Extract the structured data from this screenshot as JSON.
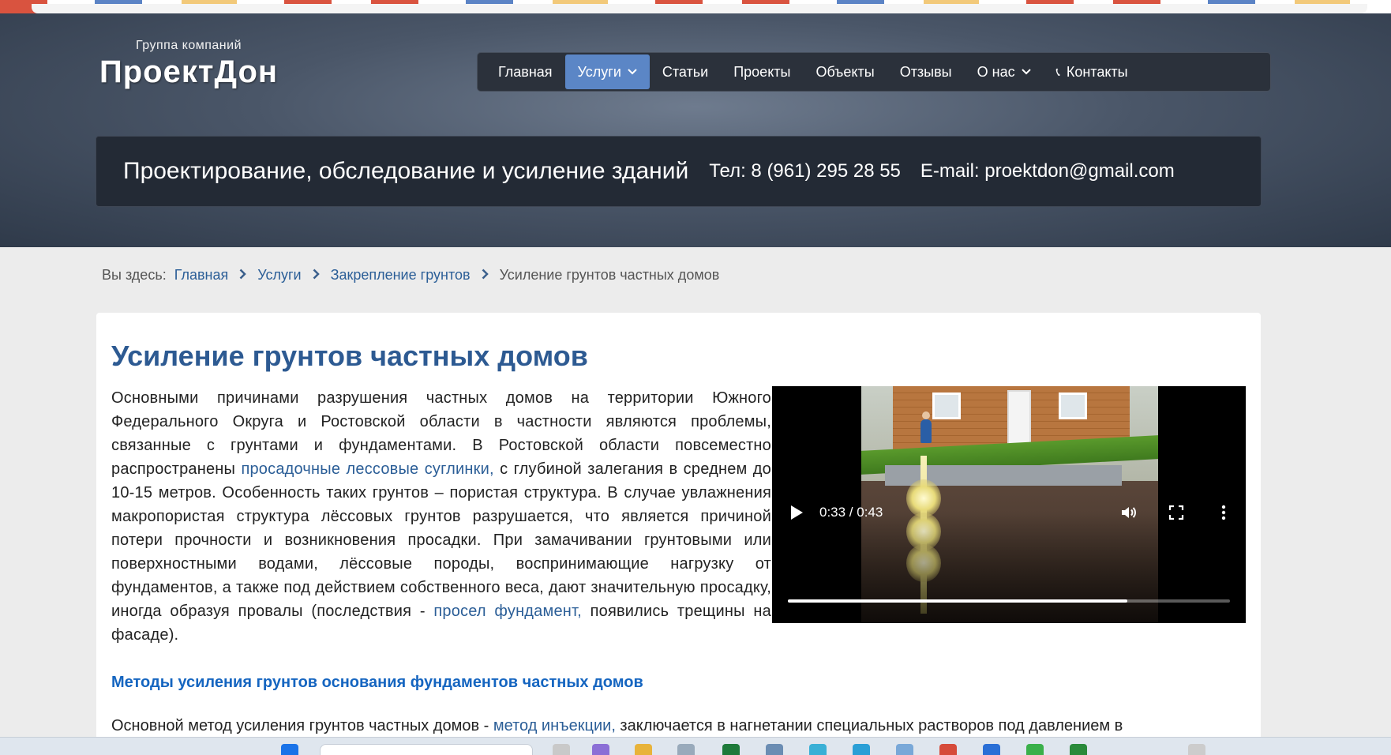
{
  "header": {
    "logo_small": "Группа компаний",
    "logo_big": "ПроектДон",
    "nav": [
      {
        "label": "Главная"
      },
      {
        "label": "Услуги",
        "active": true,
        "dropdown": true
      },
      {
        "label": "Статьи"
      },
      {
        "label": "Проекты"
      },
      {
        "label": "Объекты"
      },
      {
        "label": "Отзывы"
      },
      {
        "label": "О нас",
        "dropdown": true
      },
      {
        "label": "Контакты",
        "icon": "phone-icon"
      }
    ],
    "tagline": "Проектирование, обследование и усиление зданий",
    "phone": "Тел: 8 (961) 295 28 55",
    "email": "E-mail: proektdon@gmail.com"
  },
  "breadcrumb": {
    "prefix": "Вы здесь:",
    "items": [
      "Главная",
      "Услуги",
      "Закрепление грунтов"
    ],
    "current": "Усиление грунтов частных домов"
  },
  "article": {
    "title": "Усиление грунтов частных домов",
    "p1_a": "Основными причинами разрушения частных домов на территории Южного Федерального Округа и Ростовской области в частности являются проблемы, связанные с грунтами и фундаментами. В Ростовской области повсеместно распространены ",
    "p1_link": "просадочные лессовые суглинки,",
    "p1_b": " с глубиной залегания в среднем до 10-15 метров. Особенность таких грунтов – пористая структура. В случае увлажнения макропористая структура лёссовых грунтов разрушается, что является причиной потери прочности и возникновения просадки. При замачивании грунтовыми или поверхностными водами, лёссовые породы, воспринимающие нагрузку от фундаментов, а также под действием собственного веса, дают значительную просадку, иногда образуя провалы (последствия - ",
    "p1_link2": "просел фундамент,",
    "p1_c": " появились трещины на фасаде).",
    "subheading": "Методы усиления грунтов основания фундаментов частных домов",
    "p2_a": "Основной метод усиления грунтов частных домов - ",
    "p2_link": "метод инъекции,",
    "p2_b": " заключается в нагнетании специальных растворов под давлением в"
  },
  "video": {
    "time": "0:33 / 0:43",
    "progress": 0.767,
    "icons": [
      "play-icon",
      "volume-icon",
      "fullscreen-icon",
      "more-vert-icon"
    ]
  },
  "colors": {
    "accent": "#5b86c6",
    "link": "#2b5e97",
    "title": "#2d5a92",
    "subheading": "#1565c0"
  }
}
